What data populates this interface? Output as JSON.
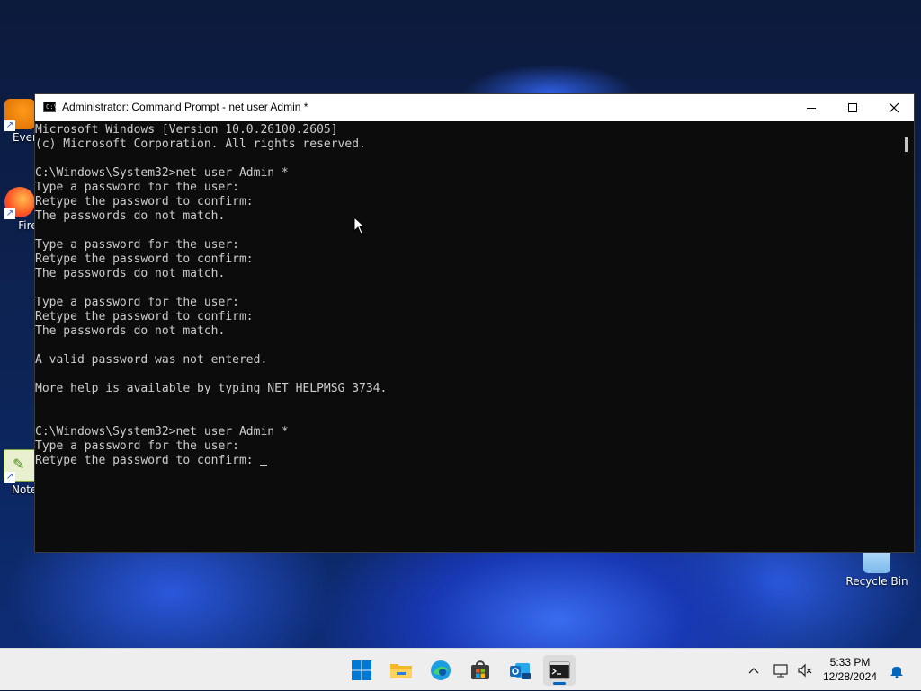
{
  "desktop": {
    "icons": [
      {
        "label": "Every",
        "icon": "everything-search-icon"
      },
      {
        "label": "Fire",
        "icon": "firefox-icon"
      },
      {
        "label": "Notep",
        "icon": "notepad-plus-plus-icon"
      },
      {
        "label": "Recycle Bin",
        "icon": "recycle-bin-icon"
      }
    ]
  },
  "window": {
    "title": "Administrator: Command Prompt - net  user Admin *",
    "icon_text": "C:\\_",
    "lines": [
      "Microsoft Windows [Version 10.0.26100.2605]",
      "(c) Microsoft Corporation. All rights reserved.",
      "",
      "C:\\Windows\\System32>net user Admin *",
      "Type a password for the user:",
      "Retype the password to confirm:",
      "The passwords do not match.",
      "",
      "Type a password for the user:",
      "Retype the password to confirm:",
      "The passwords do not match.",
      "",
      "Type a password for the user:",
      "Retype the password to confirm:",
      "The passwords do not match.",
      "",
      "A valid password was not entered.",
      "",
      "More help is available by typing NET HELPMSG 3734.",
      "",
      "",
      "C:\\Windows\\System32>net user Admin *",
      "Type a password for the user:",
      "Retype the password to confirm: "
    ]
  },
  "taskbar": {
    "apps": [
      {
        "name": "start",
        "icon": "windows-start-icon"
      },
      {
        "name": "file-explorer",
        "icon": "folder-icon"
      },
      {
        "name": "edge",
        "icon": "edge-browser-icon"
      },
      {
        "name": "store",
        "icon": "microsoft-store-icon"
      },
      {
        "name": "outlook",
        "icon": "outlook-new-icon"
      },
      {
        "name": "terminal",
        "icon": "terminal-icon",
        "active": true
      }
    ],
    "clock": {
      "time": "5:33 PM",
      "date": "12/28/2024"
    },
    "colors": {
      "accent": "#0067c0",
      "bg": "#eeeeee"
    }
  }
}
